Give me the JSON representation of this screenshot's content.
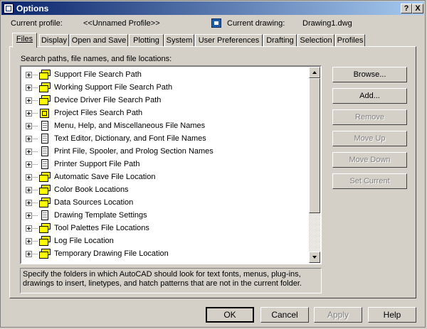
{
  "window": {
    "title": "Options",
    "help_button": "?",
    "close_button": "X"
  },
  "profile": {
    "current_profile_label": "Current profile:",
    "current_profile_value": "<<Unnamed Profile>>",
    "current_drawing_label": "Current drawing:",
    "current_drawing_value": "Drawing1.dwg"
  },
  "tabs": [
    {
      "label": "Files",
      "active": true
    },
    {
      "label": "Display"
    },
    {
      "label": "Open and Save"
    },
    {
      "label": "Plotting"
    },
    {
      "label": "System"
    },
    {
      "label": "User Preferences"
    },
    {
      "label": "Drafting"
    },
    {
      "label": "Selection"
    },
    {
      "label": "Profiles"
    }
  ],
  "files_panel": {
    "section_label": "Search paths, file names, and file locations:",
    "tree_items": [
      {
        "label": "Support File Search Path",
        "icon": "folders-icon"
      },
      {
        "label": "Working Support File Search Path",
        "icon": "folders-icon"
      },
      {
        "label": "Device Driver File Search Path",
        "icon": "folders-icon"
      },
      {
        "label": "Project Files Search Path",
        "icon": "project-icon"
      },
      {
        "label": "Menu, Help, and Miscellaneous File Names",
        "icon": "file-icon"
      },
      {
        "label": "Text Editor, Dictionary, and Font File Names",
        "icon": "file-icon"
      },
      {
        "label": "Print File, Spooler, and Prolog Section Names",
        "icon": "file-icon"
      },
      {
        "label": "Printer Support File Path",
        "icon": "file-icon"
      },
      {
        "label": "Automatic Save File Location",
        "icon": "folders-icon"
      },
      {
        "label": "Color Book Locations",
        "icon": "folders-icon"
      },
      {
        "label": "Data Sources Location",
        "icon": "folders-icon"
      },
      {
        "label": "Drawing Template Settings",
        "icon": "file-icon"
      },
      {
        "label": "Tool Palettes File Locations",
        "icon": "folders-icon"
      },
      {
        "label": "Log File Location",
        "icon": "folders-icon"
      },
      {
        "label": "Temporary Drawing File Location",
        "icon": "folders-icon"
      }
    ],
    "description": "Specify the folders in which AutoCAD should look for text fonts, menus, plug-ins, drawings to insert, linetypes, and hatch patterns that are not in the current folder.",
    "buttons": {
      "browse": "Browse...",
      "add": "Add...",
      "remove": "Remove",
      "move_up": "Move Up",
      "move_down": "Move Down",
      "set_current": "Set Current"
    }
  },
  "footer": {
    "ok": "OK",
    "cancel": "Cancel",
    "apply": "Apply",
    "help": "Help"
  }
}
